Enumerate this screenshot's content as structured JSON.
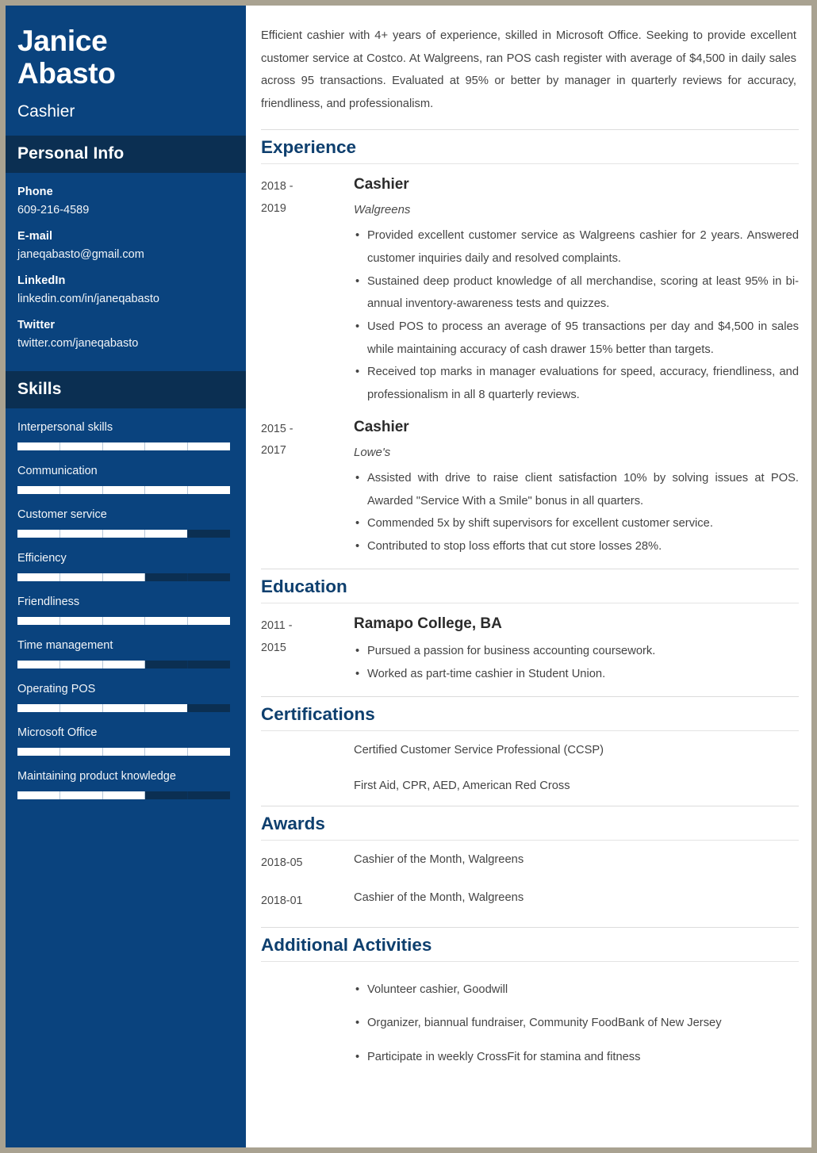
{
  "sidebar": {
    "name": "Janice Abasto",
    "name_line1": "Janice",
    "name_line2": "Abasto",
    "job_title": "Cashier",
    "personal_info_heading": "Personal Info",
    "contacts": [
      {
        "label": "Phone",
        "value": "609-216-4589"
      },
      {
        "label": "E-mail",
        "value": "janeqabasto@gmail.com"
      },
      {
        "label": "LinkedIn",
        "value": "linkedin.com/in/janeqabasto"
      },
      {
        "label": "Twitter",
        "value": "twitter.com/janeqabasto"
      }
    ],
    "skills_heading": "Skills",
    "skills": [
      {
        "label": "Interpersonal skills",
        "level": 100
      },
      {
        "label": "Communication",
        "level": 100
      },
      {
        "label": "Customer service",
        "level": 80
      },
      {
        "label": "Efficiency",
        "level": 60
      },
      {
        "label": "Friendliness",
        "level": 100
      },
      {
        "label": "Time management",
        "level": 60
      },
      {
        "label": "Operating POS",
        "level": 80
      },
      {
        "label": "Microsoft Office",
        "level": 100
      },
      {
        "label": "Maintaining product knowledge",
        "level": 60
      }
    ]
  },
  "main": {
    "summary": "Efficient cashier with 4+ years of experience, skilled in Microsoft Office. Seeking to provide excellent customer service at Costco. At Walgreens, ran POS cash register with average of $4,500 in daily sales across 95 transactions. Evaluated at 95% or better by manager in quarterly reviews for accuracy, friendliness, and professionalism.",
    "experience": {
      "heading": "Experience",
      "entries": [
        {
          "date_from": "2018 -",
          "date_to": "2019",
          "role": "Cashier",
          "org": "Walgreens",
          "bullets": [
            "Provided excellent customer service as Walgreens cashier for 2 years. Answered customer inquiries daily and resolved complaints.",
            "Sustained deep product knowledge of all merchandise, scoring at least 95% in bi-annual inventory-awareness tests and quizzes.",
            "Used POS to process an average of 95 transactions per day and $4,500 in sales while maintaining accuracy of cash drawer 15% better than targets.",
            "Received top marks in manager evaluations for speed, accuracy, friendliness, and professionalism in all 8 quarterly reviews."
          ]
        },
        {
          "date_from": "2015 -",
          "date_to": "2017",
          "role": "Cashier",
          "org": "Lowe's",
          "bullets": [
            "Assisted with drive to raise client satisfaction 10% by solving issues at POS. Awarded \"Service With a Smile\" bonus in all quarters.",
            "Commended 5x by shift supervisors for excellent customer service.",
            "Contributed to stop loss efforts that cut store losses 28%."
          ]
        }
      ]
    },
    "education": {
      "heading": "Education",
      "entries": [
        {
          "date_from": "2011 -",
          "date_to": "2015",
          "role": "Ramapo College, BA",
          "bullets": [
            "Pursued a passion for business accounting coursework.",
            "Worked as part-time cashier in Student Union."
          ]
        }
      ]
    },
    "certifications": {
      "heading": "Certifications",
      "items": [
        "Certified Customer Service Professional (CCSP)",
        "First Aid, CPR, AED, American Red Cross"
      ]
    },
    "awards": {
      "heading": "Awards",
      "items": [
        {
          "date": "2018-05",
          "text": "Cashier of the Month, Walgreens"
        },
        {
          "date": "2018-01",
          "text": "Cashier of the Month, Walgreens"
        }
      ]
    },
    "additional_activities": {
      "heading": "Additional Activities",
      "items": [
        "Volunteer cashier, Goodwill",
        "Organizer, biannual fundraiser, Community FoodBank of New Jersey",
        "Participate in weekly CrossFit for stamina and fitness"
      ]
    }
  },
  "colors": {
    "sidebar_bg": "#0a437e",
    "sidebar_band": "#0b2f52",
    "heading_blue": "#0e3f6e",
    "page_border": "#a9a291",
    "bar_fill": "#ffffff"
  }
}
